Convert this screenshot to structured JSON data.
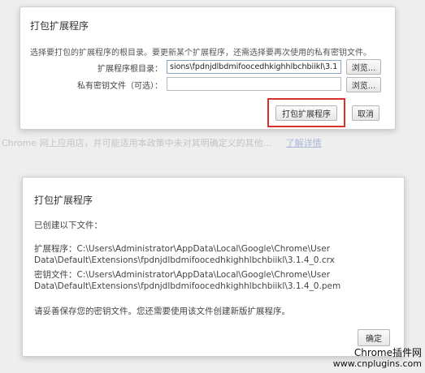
{
  "background": {
    "line1": "Chrome 网上应用店，并可能适用本政策中未对其明确定义的其他...",
    "link": "了解详情"
  },
  "pack_dialog": {
    "title": "打包扩展程序",
    "description": "选择要打包的扩展程序的根目录。要更新某个扩展程序，还需选择要再次使用的私有密钥文件。",
    "root_label": "扩展程序根目录：",
    "root_value": "sions\\fpdnjdlbdmifoocedhkighhlbchbiikl\\3.1.4_0",
    "key_label": "私有密钥文件（可选）：",
    "key_value": "",
    "browse_label": "浏览...",
    "pack_button": "打包扩展程序",
    "cancel_button": "取消"
  },
  "result_dialog": {
    "title": "打包扩展程序",
    "created_text": "已创建以下文件：",
    "ext_line1": "扩展程序：C:\\Users\\Administrator\\AppData\\Local\\Google\\Chrome\\User",
    "ext_line2": "Data\\Default\\Extensions\\fpdnjdlbdmifoocedhkighhlbchbiikl\\3.1.4_0.crx",
    "key_line1": "密钥文件：C:\\Users\\Administrator\\AppData\\Local\\Google\\Chrome\\User",
    "key_line2": "Data\\Default\\Extensions\\fpdnjdlbdmifoocedhkighhlbchbiikl\\3.1.4_0.pem",
    "warning_text": "请妥善保存您的密钥文件。您还需要使用该文件创建新版扩展程序。",
    "ok_button": "确定"
  },
  "watermark": {
    "name": "Chrome插件网",
    "url": "www.cnplugins.com"
  },
  "colors": {
    "highlight": "#d9322c",
    "page_bg": "#eeeeee",
    "dialog_bg": "#ffffff"
  }
}
